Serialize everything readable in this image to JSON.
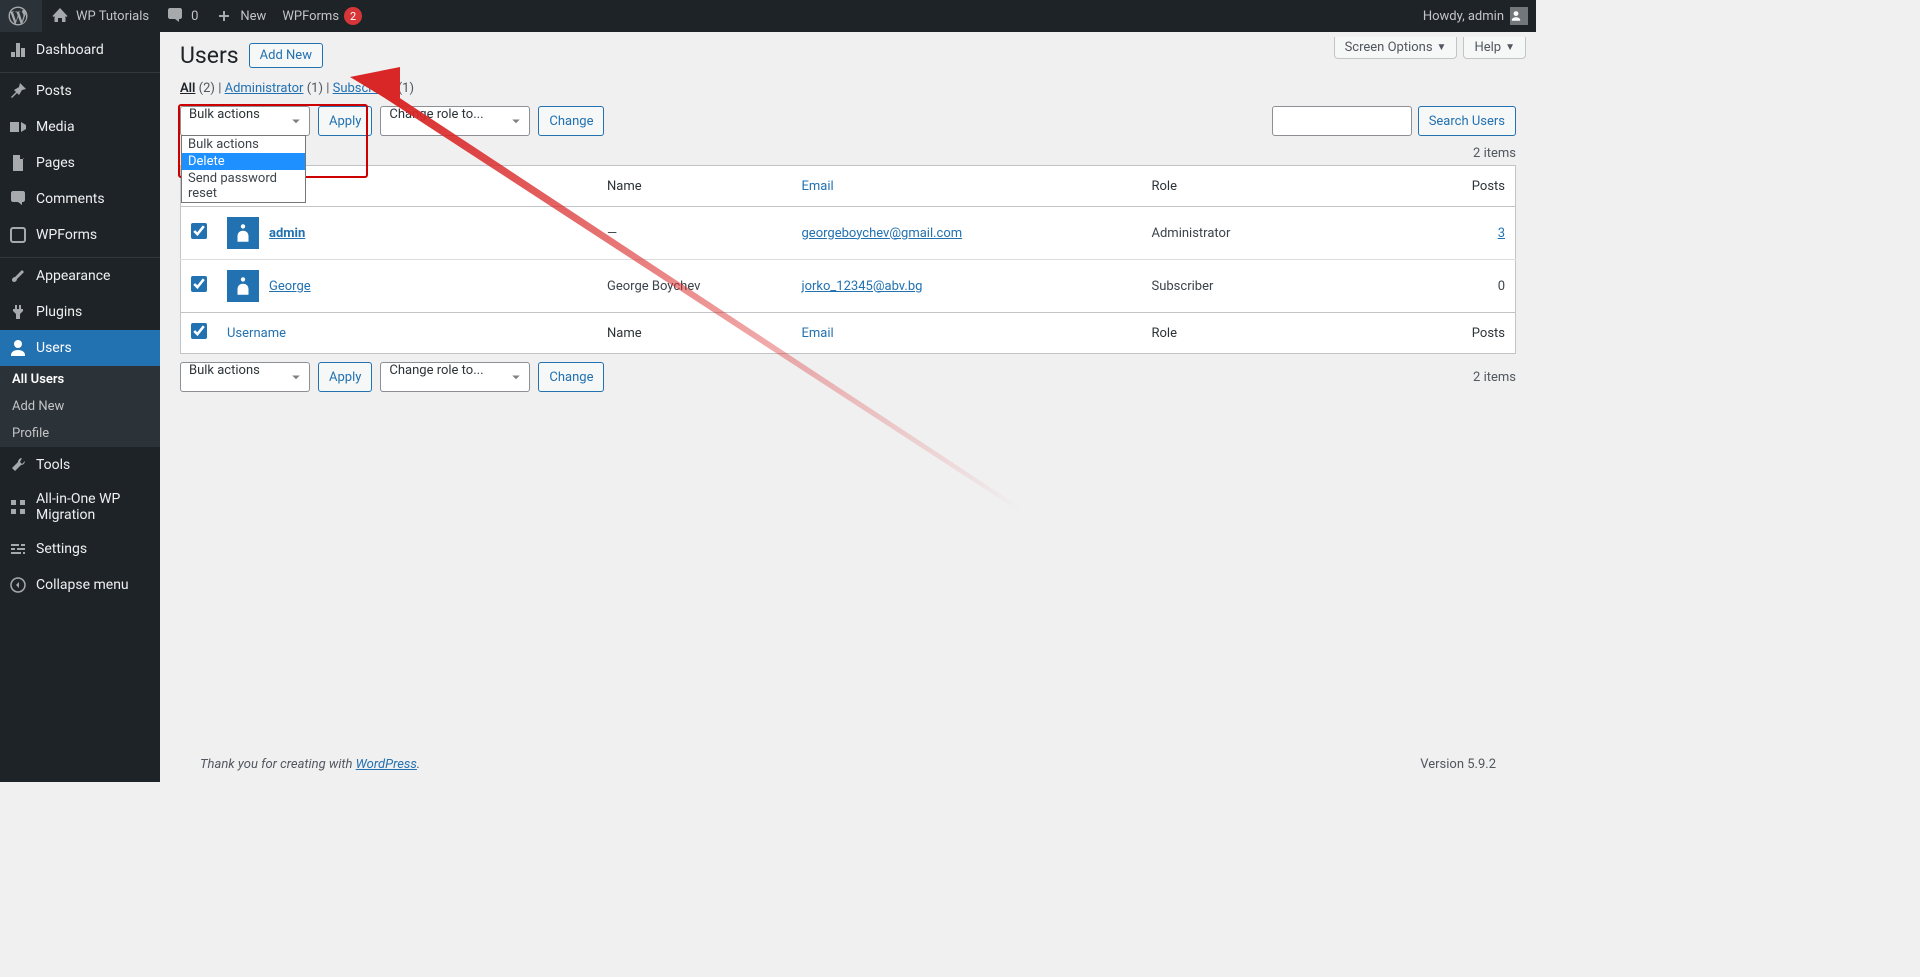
{
  "adminbar": {
    "site_name": "WP Tutorials",
    "comments_count": "0",
    "new_label": "New",
    "wpforms_label": "WPForms",
    "wpforms_badge": "2",
    "howdy": "Howdy, admin"
  },
  "sidebar": {
    "items": [
      {
        "label": "Dashboard",
        "icon": "dashboard"
      },
      {
        "label": "Posts",
        "icon": "pin"
      },
      {
        "label": "Media",
        "icon": "media"
      },
      {
        "label": "Pages",
        "icon": "page"
      },
      {
        "label": "Comments",
        "icon": "comment"
      },
      {
        "label": "WPForms",
        "icon": "wpforms"
      },
      {
        "label": "Appearance",
        "icon": "appearance"
      },
      {
        "label": "Plugins",
        "icon": "plugin"
      },
      {
        "label": "Users",
        "icon": "users",
        "current": true
      },
      {
        "label": "Tools",
        "icon": "tools"
      },
      {
        "label": "All-in-One WP Migration",
        "icon": "migrate"
      },
      {
        "label": "Settings",
        "icon": "settings"
      },
      {
        "label": "Collapse menu",
        "icon": "collapse"
      }
    ],
    "submenu": [
      {
        "label": "All Users",
        "current": true
      },
      {
        "label": "Add New"
      },
      {
        "label": "Profile"
      }
    ]
  },
  "screen_options": "Screen Options",
  "help": "Help",
  "page_title": "Users",
  "add_new": "Add New",
  "filters": {
    "all_label": "All",
    "all_count": "(2)",
    "admin_label": "Administrator",
    "admin_count": "(1)",
    "sub_label": "Subscriber",
    "sub_count": "(1)",
    "sep": " | "
  },
  "bulk": {
    "select_label": "Bulk actions",
    "apply": "Apply",
    "options": [
      "Bulk actions",
      "Delete",
      "Send password reset"
    ],
    "selected_index": 1
  },
  "role_change": {
    "select_label": "Change role to...",
    "button": "Change"
  },
  "search": {
    "button": "Search Users"
  },
  "items_count": "2 items",
  "table": {
    "cols": {
      "username": "Username",
      "name": "Name",
      "email": "Email",
      "role": "Role",
      "posts": "Posts"
    },
    "rows": [
      {
        "username": "admin",
        "name": "—",
        "email": "georgeboychev@gmail.com",
        "role": "Administrator",
        "posts": "3",
        "checked": true
      },
      {
        "username": "George",
        "name": "George Boychev",
        "email": "jorko_12345@abv.bg",
        "role": "Subscriber",
        "posts": "0",
        "checked": true
      }
    ]
  },
  "footer": {
    "thank": "Thank you for creating with ",
    "wp": "WordPress",
    "period": ".",
    "version": "Version 5.9.2"
  }
}
